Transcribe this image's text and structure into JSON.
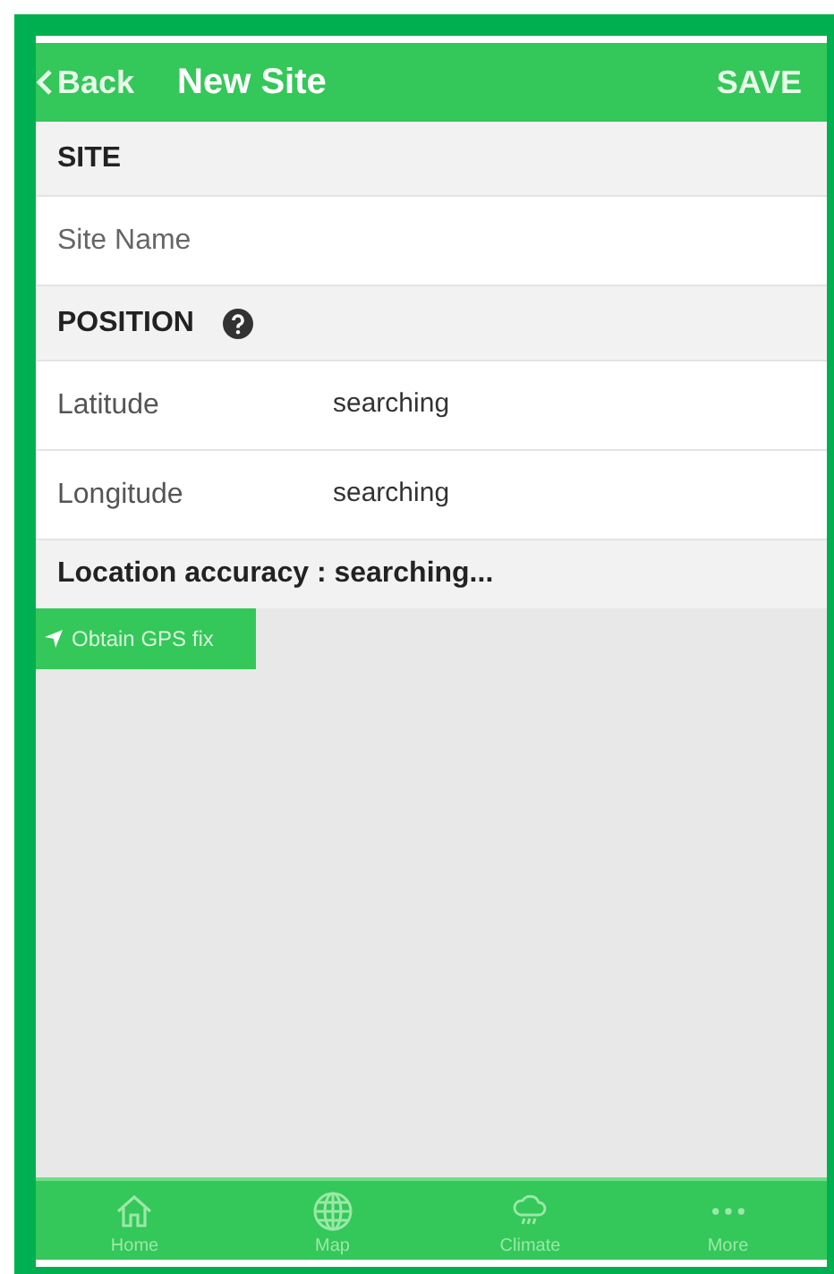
{
  "header": {
    "back": "Back",
    "title": "New Site",
    "action": "SAVE"
  },
  "site_section": {
    "title": "SITE",
    "field": {
      "placeholder": "Site Name"
    }
  },
  "position_section": {
    "title": "POSITION",
    "rows": [
      {
        "label": "Latitude",
        "value": "searching"
      },
      {
        "label": "Longitude",
        "value": "searching"
      }
    ]
  },
  "accuracy": "Location accuracy : searching...",
  "gps_button": "Obtain GPS fix",
  "tab_bar": [
    {
      "label": "Home",
      "kind": "home"
    },
    {
      "label": "Map",
      "kind": "map"
    },
    {
      "label": "Climate",
      "kind": "climate"
    },
    {
      "label": "More",
      "kind": "more"
    }
  ]
}
